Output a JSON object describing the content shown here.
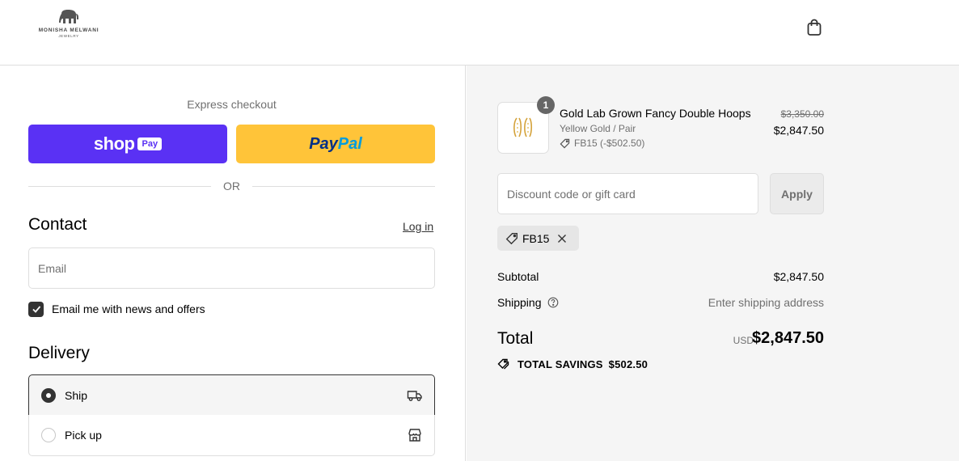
{
  "brand": {
    "name": "MONISHA MELWANI",
    "sub": "JEWELRY"
  },
  "header": {
    "cart_icon": "shopping-bag-icon"
  },
  "express": {
    "label": "Express checkout",
    "shop_word": "shop",
    "shop_badge": "Pay",
    "paypal_a": "Pay",
    "paypal_b": "Pal",
    "or": "OR",
    "colors": {
      "shop": "#5a31f4",
      "paypal": "#ffc439"
    }
  },
  "contact": {
    "title": "Contact",
    "login": "Log in",
    "email_placeholder": "Email",
    "newsletter_label": "Email me with news and offers",
    "newsletter_checked": true
  },
  "delivery": {
    "title": "Delivery",
    "options": [
      {
        "label": "Ship",
        "selected": true,
        "icon": "truck-icon"
      },
      {
        "label": "Pick up",
        "selected": false,
        "icon": "store-icon"
      }
    ]
  },
  "summary": {
    "item": {
      "quantity": "1",
      "name": "Gold Lab Grown Fancy Double Hoops",
      "variant": "Yellow Gold / Pair",
      "discount": "FB15 (-$502.50)",
      "price_original": "$3,350.00",
      "price_final": "$2,847.50"
    },
    "discount_placeholder": "Discount code or gift card",
    "apply_label": "Apply",
    "applied_code": "FB15",
    "subtotal_label": "Subtotal",
    "subtotal_value": "$2,847.50",
    "shipping_label": "Shipping",
    "shipping_value": "Enter shipping address",
    "total_label": "Total",
    "total_currency": "USD",
    "total_value": "$2,847.50",
    "savings_label": "TOTAL SAVINGS",
    "savings_value": "$502.50"
  }
}
